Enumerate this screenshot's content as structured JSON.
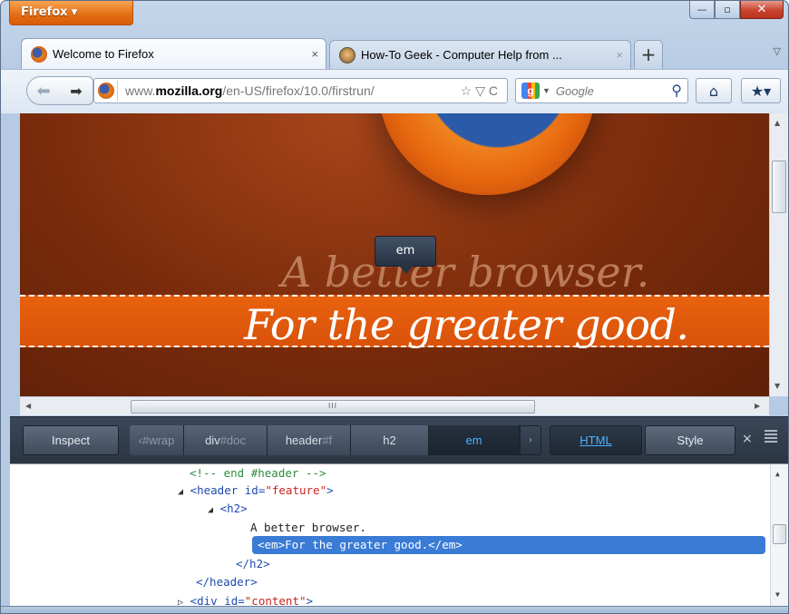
{
  "window": {
    "app_button": "Firefox",
    "caption": {
      "minimize": "—",
      "maximize": "▫",
      "close": "✕"
    }
  },
  "tabs": [
    {
      "title": "Welcome to Firefox",
      "active": true,
      "close": "×"
    },
    {
      "title": "How-To Geek - Computer Help from ...",
      "active": false,
      "close": "×"
    }
  ],
  "new_tab_label": "+",
  "tab_list_icon": "▽",
  "navbar": {
    "url_prefix": "www.",
    "url_domain": "mozilla.org",
    "url_path": "/en-US/firefox/10.0/firstrun/",
    "url_tools": "☆▽C",
    "search_placeholder": "Google",
    "search_engine": "Google"
  },
  "page": {
    "headline": "A better browser.",
    "subhead": "For the greater good.",
    "tooltip": "em"
  },
  "scrollbar": {
    "grip": "III"
  },
  "inspector": {
    "inspect_label": "Inspect",
    "breadcrumbs": [
      {
        "tag": "",
        "id": "#wrap",
        "prefix": "‹ "
      },
      {
        "tag": "div",
        "id": "#doc"
      },
      {
        "tag": "header",
        "id": "#f"
      },
      {
        "tag": "h2",
        "id": ""
      },
      {
        "tag": "em",
        "id": "",
        "selected": true
      }
    ],
    "crumb_next": "›",
    "html_label": "HTML",
    "style_label": "Style",
    "close": "×"
  },
  "html_tree": {
    "line1": "<!-- end #header -->",
    "line2_open": "<header id=",
    "line2_val": "\"feature\"",
    "line2_close": ">",
    "line3": "<h2>",
    "line4": "A better browser.",
    "line5_open": "<em>",
    "line5_text": "For the greater good.",
    "line5_close": "</em>",
    "line6": "</h2>",
    "line7": "</header>",
    "line8_open": "<div id=",
    "line8_val": "\"content\"",
    "line8_close": ">"
  }
}
